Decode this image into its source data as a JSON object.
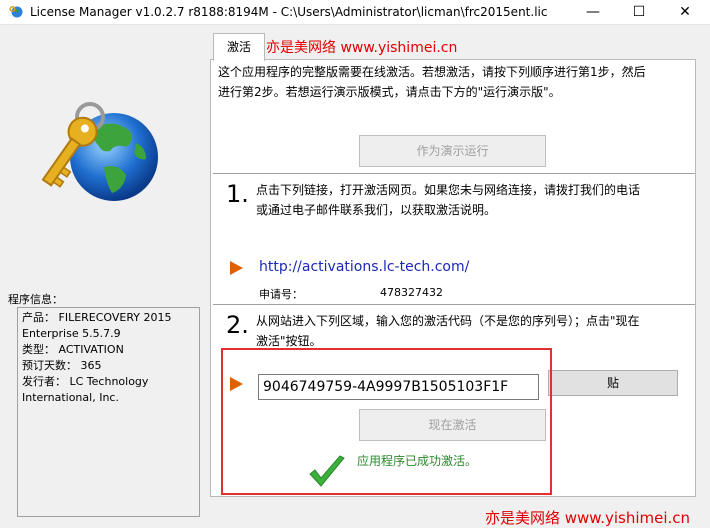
{
  "window": {
    "title": "License Manager v1.0.2.7 r8188:8194M - C:\\Users\\Administrator\\licman\\frc2015ent.lic",
    "minimize": "—",
    "maximize": "☐",
    "close": "✕"
  },
  "watermark": "亦是美网络 www.yishimei.cn",
  "left": {
    "info_label": "程序信息：",
    "info_lines": [
      "产品：   FILERECOVERY 2015",
      "Enterprise 5.5.7.9",
      "类型：  ACTIVATION",
      "预订天数：  365",
      "发行者：  LC Technology",
      "International, Inc."
    ]
  },
  "tabs": [
    "激活"
  ],
  "intro": {
    "line1": "这个应用程序的完整版需要在线激活。若想激活，请按下列顺序进行第1步，然后",
    "line2": "进行第2步。若想运行演示版模式，请点击下方的\"运行演示版\"。"
  },
  "demo_button": "作为演示运行",
  "step1": {
    "number": "1.",
    "line1": "点击下列链接，打开激活网页。如果您未与网络连接，请拨打我们的电话",
    "line2": "或通过电子邮件联系我们，以获取激活说明。",
    "link": "http://activations.lc-tech.com/",
    "request_label": "申请号：",
    "request_value": "478327432"
  },
  "step2": {
    "number": "2.",
    "line1": "从网站进入下列区域，输入您的激活代码（不是您的序列号）；点击\"现在",
    "line2": "激活\"按钮。",
    "code_value": "9046749759-4A9997B1505103F1F",
    "paste_button": "贴",
    "activate_button": "现在激活",
    "success_text": "应用程序已成功激活。"
  },
  "colors": {
    "accent_red": "#e23030",
    "arrow_orange": "#e06000",
    "link_blue": "#1a28b5",
    "success_green": "#2b8a2b"
  }
}
